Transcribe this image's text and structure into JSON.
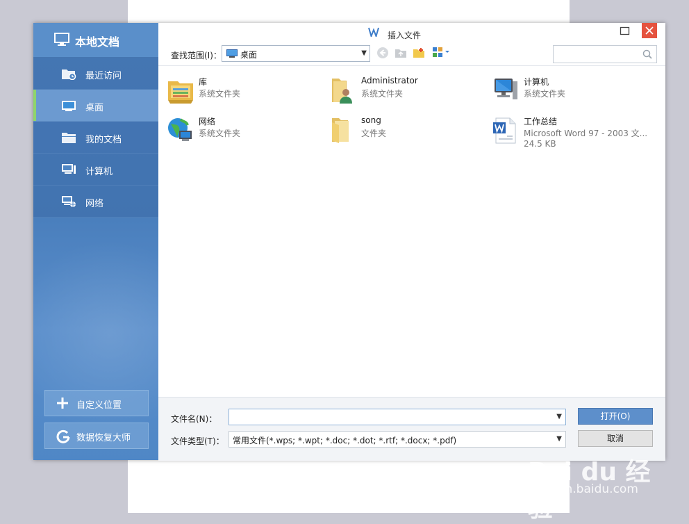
{
  "dialog": {
    "title": "插入文件"
  },
  "sidebar": {
    "header": "本地文档",
    "items": [
      {
        "label": "最近访问",
        "active": false
      },
      {
        "label": "桌面",
        "active": true
      },
      {
        "label": "我的文档",
        "active": false
      },
      {
        "label": "计算机",
        "active": false
      },
      {
        "label": "网络",
        "active": false
      }
    ],
    "custom_location": "自定义位置",
    "data_recovery": "数据恢复大师"
  },
  "toolbar": {
    "lookin_label": "查找范围(I)：",
    "lookin_value": "桌面",
    "search_placeholder": ""
  },
  "files": [
    {
      "name": "库",
      "type": "系统文件夹",
      "size": "",
      "icon": "library-icon"
    },
    {
      "name": "Administrator",
      "type": "系统文件夹",
      "size": "",
      "icon": "user-folder-icon"
    },
    {
      "name": "计算机",
      "type": "系统文件夹",
      "size": "",
      "icon": "computer-icon"
    },
    {
      "name": "网络",
      "type": "系统文件夹",
      "size": "",
      "icon": "network-icon"
    },
    {
      "name": "song",
      "type": "文件夹",
      "size": "",
      "icon": "folder-icon"
    },
    {
      "name": "工作总结",
      "type": "Microsoft Word 97 - 2003 文...",
      "size": "24.5 KB",
      "icon": "word-doc-icon"
    }
  ],
  "bottom": {
    "filename_label": "文件名(N)：",
    "filename_value": "",
    "filetype_label": "文件类型(T)：",
    "filetype_value": "常用文件(*.wps; *.wpt; *.doc; *.dot; *.rtf; *.docx; *.pdf)",
    "open_label": "打开(O)",
    "cancel_label": "取消"
  },
  "watermark": {
    "brand": "Bai du 经验",
    "url": "jingyan.baidu.com"
  },
  "colors": {
    "sidebar_blue": "#4f86c4",
    "active_indicator": "#8ed56b",
    "close_red": "#e5533f",
    "open_button": "#5d8fcb"
  }
}
